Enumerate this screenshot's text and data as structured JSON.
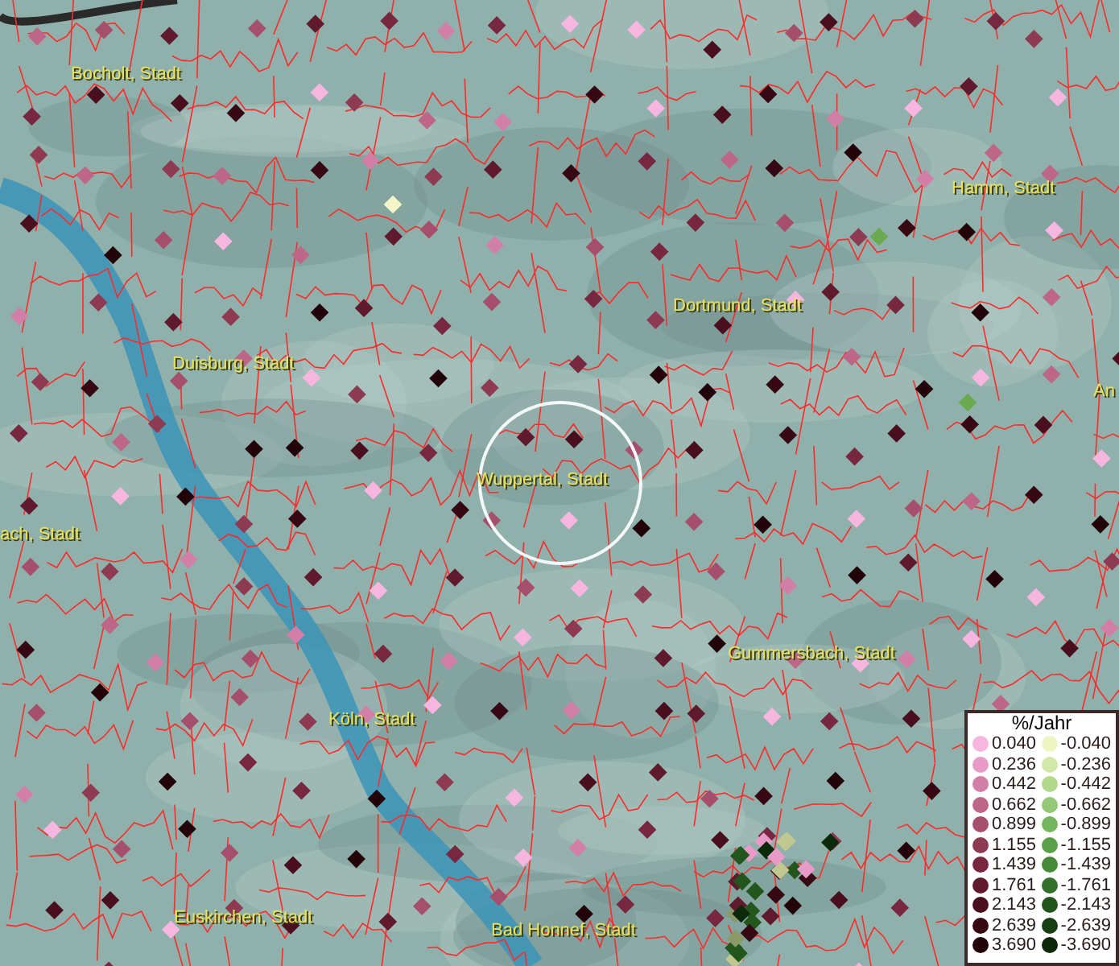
{
  "map": {
    "places": [
      {
        "name": "Bocholt, Stadt"
      },
      {
        "name": "Hamm, Stadt"
      },
      {
        "name": "Dortmund, Stadt"
      },
      {
        "name": "Duisburg, Stadt"
      },
      {
        "name": "An"
      },
      {
        "name": "Wuppertal, Stadt"
      },
      {
        "name": "ach, Stadt"
      },
      {
        "name": "Gummersbach, Stadt"
      },
      {
        "name": "Köln, Stadt"
      },
      {
        "name": "Euskirchen, Stadt"
      },
      {
        "name": "Bad Honnef, Stadt"
      }
    ]
  },
  "legend": {
    "title": "%/Jahr",
    "rows": [
      {
        "positive": {
          "value": "0.040",
          "color": "#f7b6e0"
        },
        "negative": {
          "value": "-0.040",
          "color": "#eef5c0"
        }
      },
      {
        "positive": {
          "value": "0.236",
          "color": "#e89ac8"
        },
        "negative": {
          "value": "-0.236",
          "color": "#d2e8a8"
        }
      },
      {
        "positive": {
          "value": "0.442",
          "color": "#d27fa8"
        },
        "negative": {
          "value": "-0.442",
          "color": "#b2d88c"
        }
      },
      {
        "positive": {
          "value": "0.662",
          "color": "#bd6688"
        },
        "negative": {
          "value": "-0.662",
          "color": "#93c878"
        }
      },
      {
        "positive": {
          "value": "0.899",
          "color": "#a54f6c"
        },
        "negative": {
          "value": "-0.899",
          "color": "#74b55e"
        }
      },
      {
        "positive": {
          "value": "1.155",
          "color": "#8d3a52"
        },
        "negative": {
          "value": "-1.155",
          "color": "#5aa048"
        }
      },
      {
        "positive": {
          "value": "1.439",
          "color": "#77273f"
        },
        "negative": {
          "value": "-1.439",
          "color": "#468b38"
        }
      },
      {
        "positive": {
          "value": "1.761",
          "color": "#601a2e"
        },
        "negative": {
          "value": "-1.761",
          "color": "#33702a"
        }
      },
      {
        "positive": {
          "value": "2.143",
          "color": "#4a0f1e"
        },
        "negative": {
          "value": "-2.143",
          "color": "#22561d"
        }
      },
      {
        "positive": {
          "value": "2.639",
          "color": "#360813"
        },
        "negative": {
          "value": "-2.639",
          "color": "#163f13"
        }
      },
      {
        "positive": {
          "value": "3.690",
          "color": "#22030a"
        },
        "negative": {
          "value": "-3.690",
          "color": "#0c2a0a"
        }
      }
    ]
  }
}
